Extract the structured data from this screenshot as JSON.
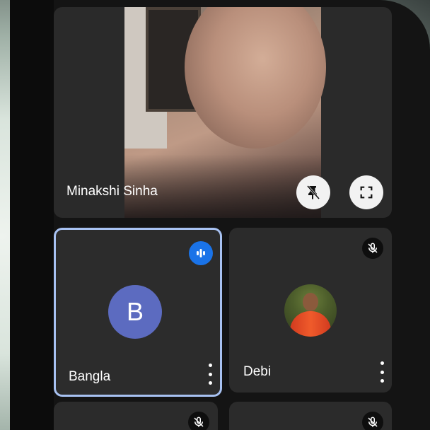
{
  "main_tile": {
    "participant_name": "Minakshi Sinha",
    "unpin_icon": "pin-off-icon",
    "fullscreen_icon": "fullscreen-icon"
  },
  "tiles": [
    {
      "name": "Bangla",
      "avatar_letter": "B",
      "avatar_color": "#5c6bc0",
      "status": "speaking",
      "status_icon": "audio-level-icon",
      "highlight_color": "#a8c2f2"
    },
    {
      "name": "Debi",
      "avatar": "photo",
      "status": "muted",
      "status_icon": "mic-off-icon"
    }
  ],
  "partial_tiles": [
    {
      "status": "muted",
      "status_icon": "mic-off-icon"
    },
    {
      "status": "muted",
      "status_icon": "mic-off-icon"
    }
  ],
  "colors": {
    "speaking": "#1a73e8",
    "tile_bg": "#2b2b2b",
    "screen_bg": "#141414"
  }
}
